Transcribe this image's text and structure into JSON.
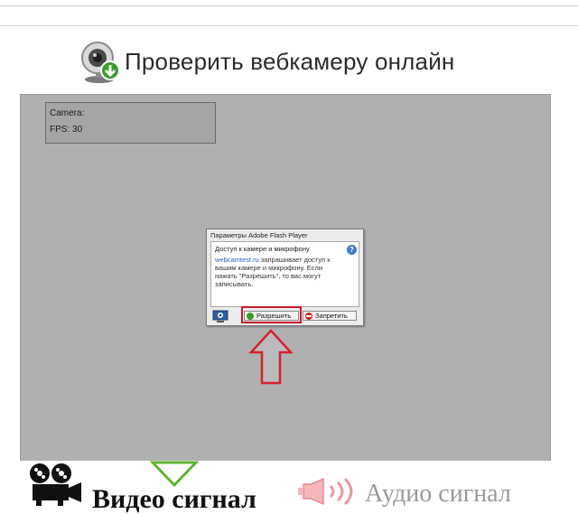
{
  "page": {
    "title": "Проверить вебкамеру онлайн"
  },
  "camera_info": {
    "camera_label": "Camera:",
    "fps_label": "FPS: 30"
  },
  "flash_dialog": {
    "title": "Параметры Adobe Flash Player",
    "heading": "Доступ к камере и микрофону",
    "link_text": "webcamtest.ru",
    "message": " запрашивает доступ к вашим камере и микрофону. Если нажать \"Разрешить\", то вас могут записывать.",
    "help_glyph": "?",
    "allow_label": "Разрешить",
    "deny_label": "Запретить"
  },
  "signals": {
    "video_label": "Видео сигнал",
    "audio_label": "Аудио сигнал"
  },
  "colors": {
    "stage_bg": "#b0b0b0",
    "highlight_red": "#c8192a",
    "accent_green": "#3a9b2e",
    "link_blue": "#2b5fb4"
  }
}
